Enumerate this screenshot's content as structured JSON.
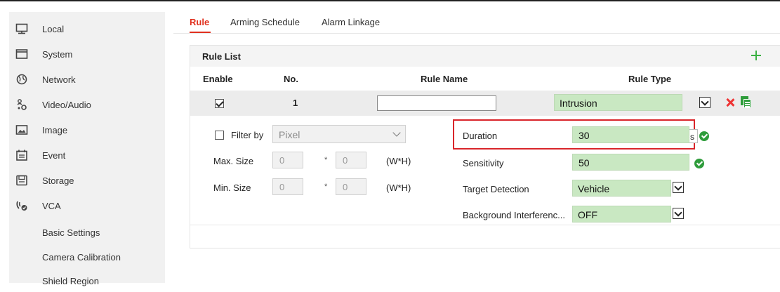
{
  "sidebar": {
    "items": [
      {
        "label": "Local",
        "icon": "monitor-icon"
      },
      {
        "label": "System",
        "icon": "system-icon"
      },
      {
        "label": "Network",
        "icon": "globe-icon"
      },
      {
        "label": "Video/Audio",
        "icon": "video-audio-icon"
      },
      {
        "label": "Image",
        "icon": "image-icon"
      },
      {
        "label": "Event",
        "icon": "calendar-icon"
      },
      {
        "label": "Storage",
        "icon": "disk-icon"
      },
      {
        "label": "VCA",
        "icon": "vca-icon"
      }
    ],
    "subitems": [
      {
        "label": "Basic Settings"
      },
      {
        "label": "Camera Calibration"
      },
      {
        "label": "Shield Region"
      }
    ]
  },
  "tabs": [
    {
      "label": "Rule",
      "active": true
    },
    {
      "label": "Arming Schedule",
      "active": false
    },
    {
      "label": "Alarm Linkage",
      "active": false
    }
  ],
  "rule_list": {
    "title": "Rule List",
    "columns": {
      "enable": "Enable",
      "no": "No.",
      "name": "Rule Name",
      "type": "Rule Type"
    },
    "rows": [
      {
        "enabled": true,
        "no": "1",
        "name": "",
        "type": "Intrusion"
      }
    ]
  },
  "detail": {
    "filter_by_label": "Filter by",
    "filter_by_checked": false,
    "filter_by_value": "Pixel",
    "max_size_label": "Max. Size",
    "min_size_label": "Min. Size",
    "max_w": "0",
    "max_h": "0",
    "min_w": "0",
    "min_h": "0",
    "times": "*",
    "wh_unit": "(W*H)",
    "duration_label": "Duration",
    "duration_value": "30",
    "duration_unit": "s",
    "sensitivity_label": "Sensitivity",
    "sensitivity_value": "50",
    "target_detection_label": "Target Detection",
    "target_detection_value": "Vehicle",
    "background_label": "Background Interferenc...",
    "background_value": "OFF"
  },
  "colors": {
    "accent": "#e0301e",
    "success": "#2e9c3b",
    "field_green": "#c9e8c2",
    "highlight": "#d9252a"
  }
}
